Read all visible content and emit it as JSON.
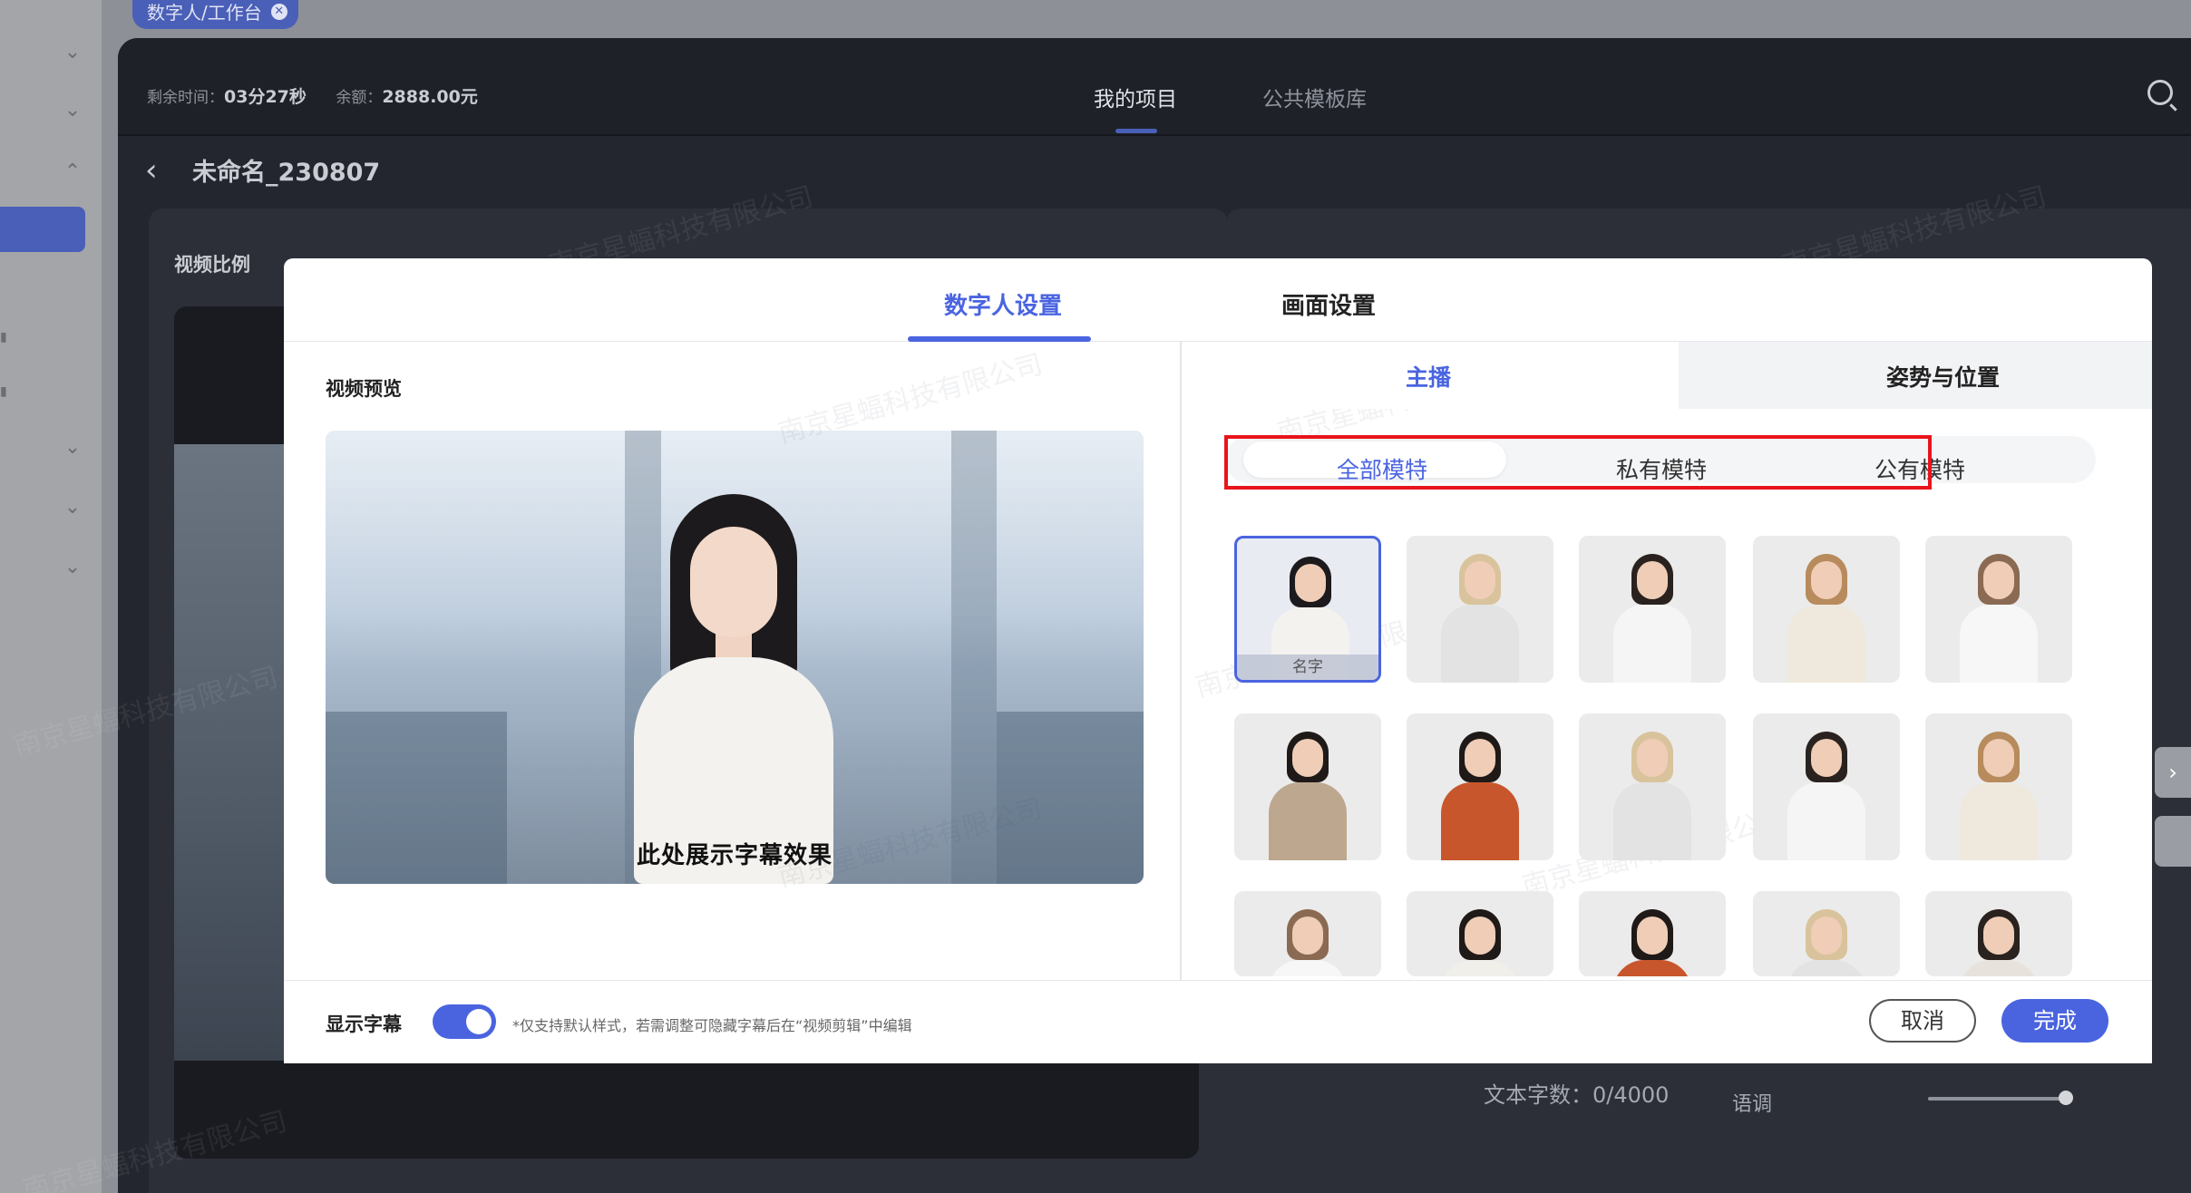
{
  "app": {
    "breadcrumb_tag": "数字人/工作台",
    "remaining_time_label": "剩余时间：",
    "remaining_time_value": "03分27秒",
    "balance_label": "余额：",
    "balance_value": "2888.00元",
    "tabs": [
      "我的项目",
      "公共模板库"
    ],
    "project_name": "未命名_230807",
    "video_ratio_label": "视频比例",
    "text_count": "文本字数：0/4000",
    "tone_label": "语调",
    "watermark": "南京星蝠科技有限公司"
  },
  "modal": {
    "tabs": [
      "数字人设置",
      "画面设置"
    ],
    "preview_title": "视频预览",
    "subtitle_preview": "此处展示字幕效果",
    "sub_tabs": [
      "主播",
      "姿势与位置"
    ],
    "segments": [
      "全部模特",
      "私有模特",
      "公有模特"
    ],
    "selected_card_label": "名字",
    "footer": {
      "show_subtitle_label": "显示字幕",
      "subtitle_enabled": true,
      "hint": "*仅支持默认样式，若需调整可隐藏字幕后在“视频剪辑”中编辑",
      "cancel": "取消",
      "done": "完成"
    }
  },
  "models": [
    {
      "hair": "#1c1a1c",
      "top": "#f4f2ee",
      "selected": true
    },
    {
      "hair": "#d9c39c",
      "top": "#e3e3e3"
    },
    {
      "hair": "#2a221e",
      "top": "#f5f5f5"
    },
    {
      "hair": "#b78b5c",
      "top": "#efe9dd"
    },
    {
      "hair": "#8a6a52",
      "top": "#f7f7f7"
    },
    {
      "hair": "#1f1a18",
      "top": "#bda78f"
    },
    {
      "hair": "#1f1a18",
      "top": "#c8562c"
    },
    {
      "hair": "#d9c39c",
      "top": "#e3e3e3"
    },
    {
      "hair": "#2a221e",
      "top": "#f5f5f5"
    },
    {
      "hair": "#b78b5c",
      "top": "#efe9dd"
    },
    {
      "hair": "#8a6a52",
      "top": "#f7f7f7"
    },
    {
      "hair": "#1f1a18",
      "top": "#f0efe9"
    },
    {
      "hair": "#1f1a18",
      "top": "#c8562c"
    },
    {
      "hair": "#d9c39c",
      "top": "#e3e3e3"
    },
    {
      "hair": "#2a221e",
      "top": "#e7e3dc"
    }
  ],
  "colors": {
    "accent": "#4a64e0",
    "highlight_box": "#e8141c"
  }
}
